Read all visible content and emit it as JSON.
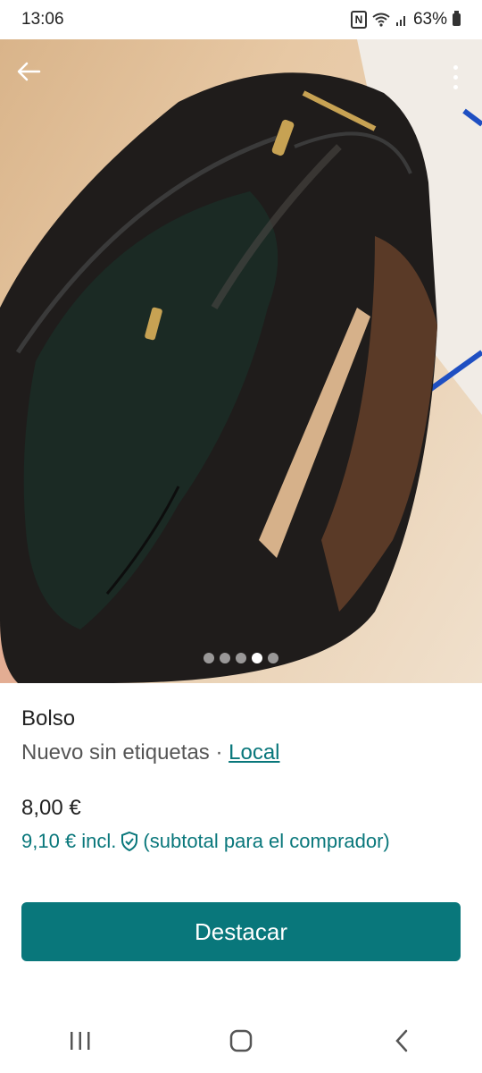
{
  "status_bar": {
    "time": "13:06",
    "battery": "63%"
  },
  "photo": {
    "page_count": 5,
    "active_page": 4
  },
  "product": {
    "title": "Bolso",
    "condition": "Nuevo sin etiquetas",
    "separator": " · ",
    "location_link": "Local",
    "price": "8,00 €",
    "price_incl": "9,10 € incl.",
    "subtotal_note": "(subtotal para el comprador)"
  },
  "actions": {
    "cta_label": "Destacar"
  },
  "colors": {
    "accent": "#09777b"
  }
}
